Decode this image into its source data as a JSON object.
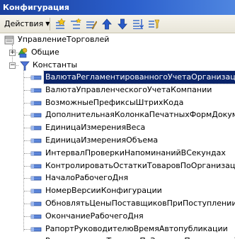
{
  "window": {
    "title": "Конфигурация"
  },
  "toolbar": {
    "actions_label": "Действия",
    "buttons": [
      {
        "icon": "add-icon"
      },
      {
        "icon": "add-child-icon"
      },
      {
        "icon": "edit-icon"
      },
      {
        "icon": "move-up-icon"
      },
      {
        "icon": "move-down-icon"
      },
      {
        "icon": "sort-icon"
      },
      {
        "icon": "filter-icon"
      }
    ]
  },
  "tree": {
    "root": {
      "label": "УправлениеТорговлей",
      "icon": "config-root-icon"
    },
    "general": {
      "label": "Общие",
      "icon": "general-group-icon",
      "expanded": false
    },
    "constants": {
      "label": "Константы",
      "icon": "constants-group-icon",
      "expanded": true
    },
    "items": [
      {
        "label": "ВалютаРегламентированногоУчетаОрганизаций",
        "selected": true
      },
      {
        "label": "ВалютаУправленческогоУчетаКомпании"
      },
      {
        "label": "ВозможныеПрефиксыШтрихКода"
      },
      {
        "label": "ДополнительнаяКолонкаПечатныхФормДокументов"
      },
      {
        "label": "ЕдиницаИзмеренияВеса"
      },
      {
        "label": "ЕдиницаИзмеренияОбъема"
      },
      {
        "label": "ИнтервалПроверкиНапоминанийВСекундах"
      },
      {
        "label": "КонтролироватьОстаткиТоваровПоОрганизациям"
      },
      {
        "label": "НачалоРабочегоДня"
      },
      {
        "label": "НомерВерсииКонфигурации"
      },
      {
        "label": "ОбновлятьЦеныПоставщиковПриПоступленииТоваров"
      },
      {
        "label": "ОкончаниеРабочегоДня"
      },
      {
        "label": "РапортРуководителюВремяАвтопубликации"
      },
      {
        "label": "РезервироватьТоваровПоЗаказамПокупателей"
      }
    ]
  }
}
